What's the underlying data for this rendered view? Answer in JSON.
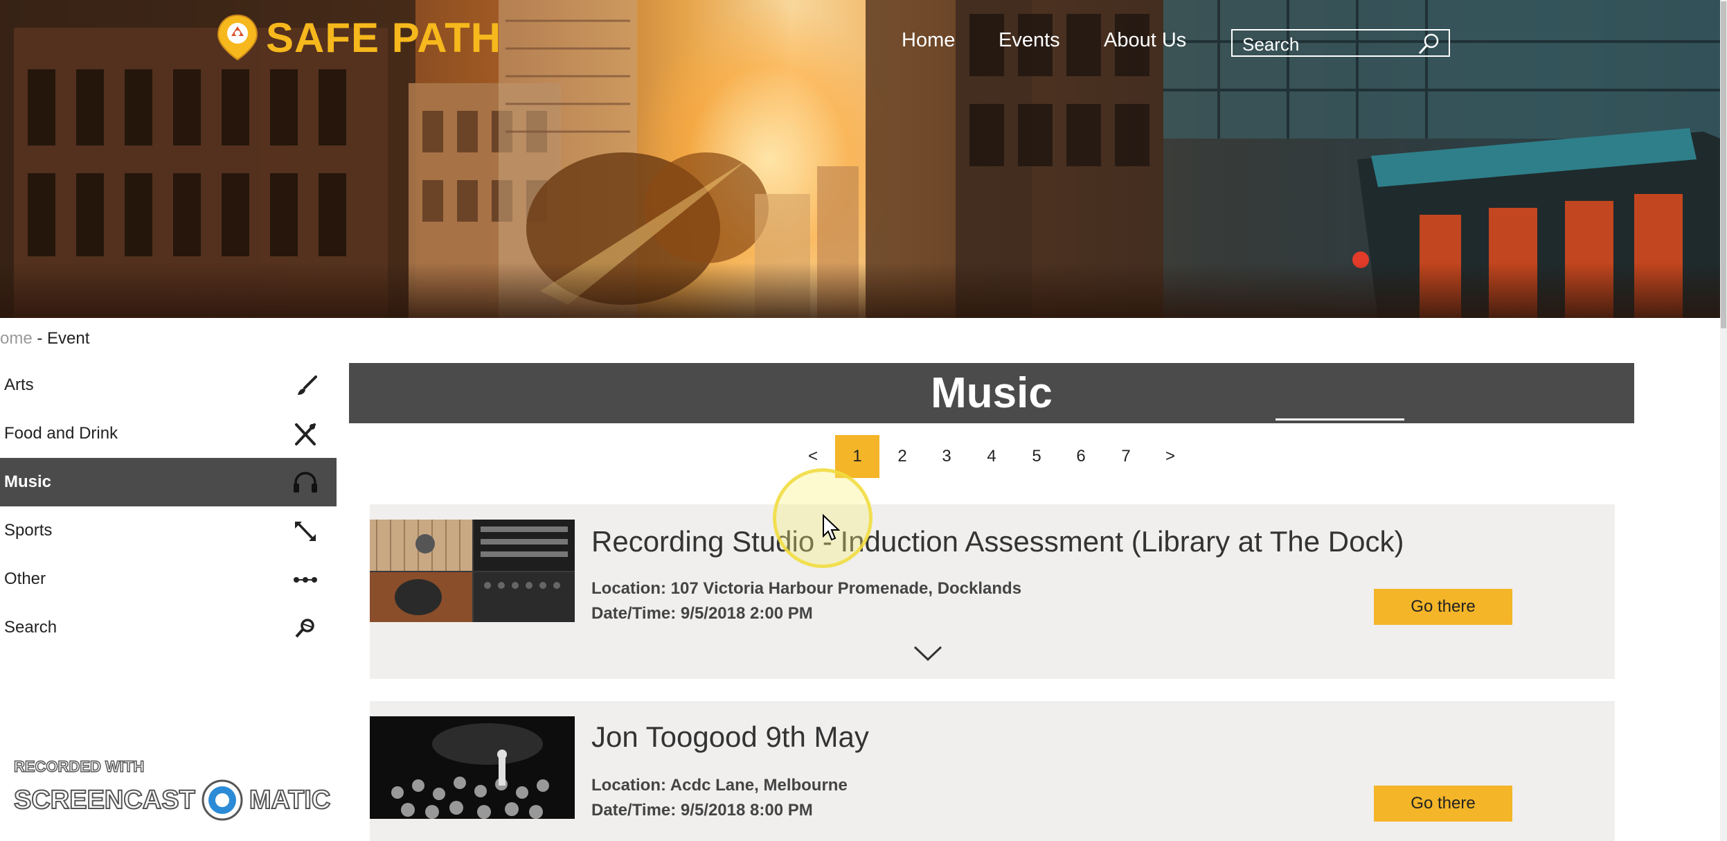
{
  "brand": {
    "name": "SAFE PATH",
    "color": "#f6b81c"
  },
  "nav": {
    "home": "Home",
    "events": "Events",
    "about": "About Us"
  },
  "search": {
    "placeholder": "Search"
  },
  "breadcrumb": {
    "home": "ome",
    "sep": " - ",
    "current": "Event"
  },
  "sidebar": {
    "items": [
      {
        "label": "Arts",
        "icon": "paintbrush-icon"
      },
      {
        "label": "Food and Drink",
        "icon": "fork-knife-icon"
      },
      {
        "label": "Music",
        "icon": "headphones-icon",
        "active": true
      },
      {
        "label": "Sports",
        "icon": "expand-arrows-icon"
      },
      {
        "label": "Other",
        "icon": "ellipsis-icon"
      },
      {
        "label": "Search",
        "icon": "search-icon"
      }
    ]
  },
  "category": {
    "title": "Music"
  },
  "pagination": {
    "prev": "<",
    "next": ">",
    "pages": [
      "1",
      "2",
      "3",
      "4",
      "5",
      "6",
      "7"
    ],
    "current": "1"
  },
  "events": [
    {
      "title": "Recording Studio - Induction Assessment (Library at The Dock)",
      "location": "Location: 107 Victoria Harbour Promenade, Docklands",
      "datetime": "Date/Time: 9/5/2018 2:00 PM",
      "button": "Go there"
    },
    {
      "title": "Jon Toogood 9th May",
      "location": "Location: Acdc Lane, Melbourne",
      "datetime": "Date/Time: 9/5/2018 8:00 PM",
      "button": "Go there"
    }
  ],
  "watermark": {
    "line1": "RECORDED WITH",
    "line2a": "SCREENCAST",
    "line2b": "MATIC"
  },
  "colors": {
    "accent": "#f4b528",
    "dark": "#4b4b4b",
    "card": "#f0efee"
  }
}
